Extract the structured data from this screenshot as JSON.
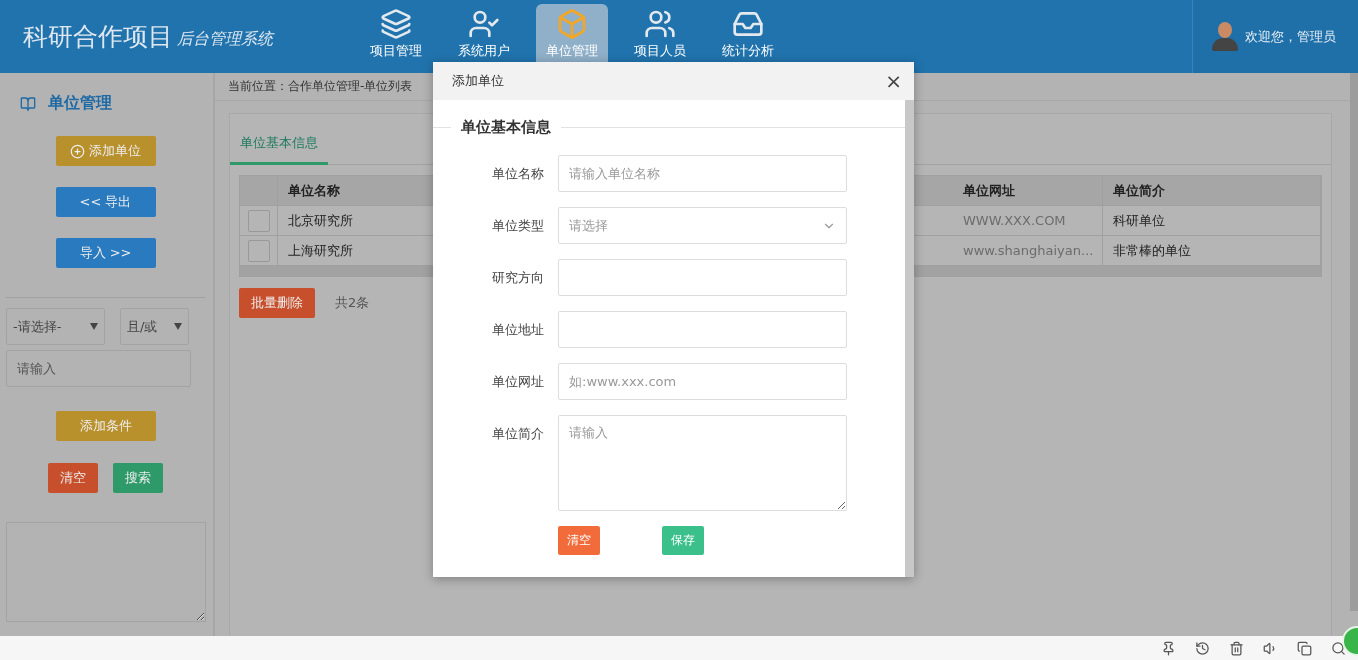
{
  "header": {
    "title": "科研合作项目",
    "subtitle": "后台管理系统",
    "user": "欢迎您，管理员"
  },
  "nav": [
    {
      "label": "项目管理",
      "selected": false
    },
    {
      "label": "系统用户",
      "selected": false
    },
    {
      "label": "单位管理",
      "selected": true
    },
    {
      "label": "项目人员",
      "selected": false
    },
    {
      "label": "统计分析",
      "selected": false
    }
  ],
  "sidebar": {
    "title": "单位管理",
    "actions": [
      {
        "label": "添加单位",
        "kind": "warning",
        "icon": true
      },
      {
        "label": "<< 导出",
        "kind": "primary",
        "icon": false
      },
      {
        "label": "导入 >>",
        "kind": "primary",
        "icon": false
      }
    ],
    "filter": {
      "field": "-请选择-",
      "logic": "且/或",
      "placeholder": "请输入"
    },
    "add_condition": {
      "label": "添加条件",
      "kind": "warning"
    },
    "buttons": [
      {
        "label": "清空",
        "kind": "danger"
      },
      {
        "label": "搜索",
        "kind": "success"
      }
    ]
  },
  "breadcrumb": "当前位置：合作单位管理-单位列表",
  "tabs": [
    {
      "label": "单位基本信息",
      "selected": true
    }
  ],
  "table": {
    "columns": [
      "单位名称",
      "单位网址",
      "单位简介"
    ],
    "rows": [
      {
        "checked": false,
        "cells": [
          "北京研究所",
          "WWW.XXX.COM",
          "科研单位"
        ]
      },
      {
        "checked": false,
        "cells": [
          "上海研究所",
          "www.shanghaiyan...",
          "非常棒的单位"
        ]
      }
    ]
  },
  "batch_delete": "批量删除",
  "total": "共2条",
  "dialog": {
    "title": "添加单位",
    "close": "×",
    "legend": "单位基本信息",
    "fields": [
      {
        "label": "单位名称",
        "kind": "input",
        "placeholder": "请输入单位名称"
      },
      {
        "label": "单位类型",
        "kind": "select",
        "placeholder": "请选择"
      },
      {
        "label": "研究方向",
        "kind": "input"
      },
      {
        "label": "单位地址",
        "kind": "input"
      },
      {
        "label": "单位网址",
        "kind": "input",
        "placeholder": "如:www.xxx.com"
      },
      {
        "label": "单位简介",
        "kind": "textarea",
        "placeholder": "请输入"
      }
    ],
    "buttons": [
      {
        "label": "清空",
        "kind": "danger"
      },
      {
        "label": "保存",
        "kind": "success"
      }
    ]
  }
}
